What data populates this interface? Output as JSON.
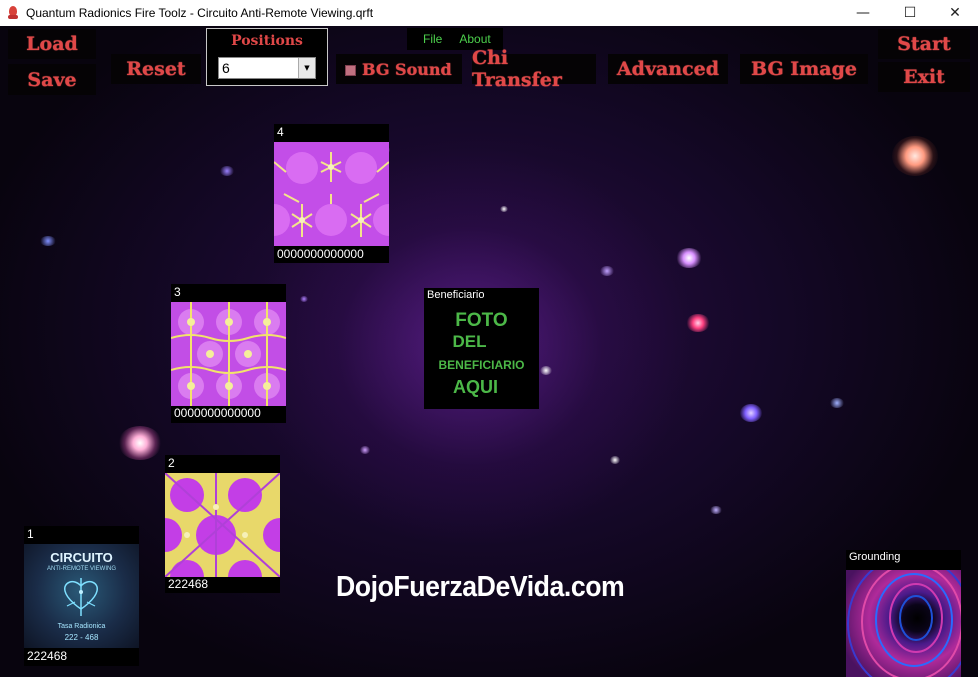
{
  "window": {
    "title": "Quantum Radionics Fire Toolz - Circuito Anti-Remote Viewing.qrft",
    "minimize_glyph": "—",
    "maximize_glyph": "☐",
    "close_glyph": "✕"
  },
  "menu": [
    {
      "label": "File"
    },
    {
      "label": "About"
    }
  ],
  "toolbar": {
    "load": "Load",
    "save": "Save",
    "reset": "Reset",
    "positions_label": "Positions",
    "positions_value": "6",
    "bg_sound": "BG Sound",
    "chi_transfer": "Chi Transfer",
    "advanced": "Advanced",
    "bg_image": "BG Image",
    "start": "Start",
    "exit": "Exit"
  },
  "cards": {
    "pos4": {
      "label": "4",
      "value": "0000000000000"
    },
    "pos3": {
      "label": "3",
      "value": "0000000000000"
    },
    "pos2": {
      "label": "2",
      "value": "222468"
    },
    "pos1": {
      "label": "1",
      "value": "222468",
      "image_title": "CIRCUITO",
      "image_subtitle": "ANTI-REMOTE VIEWING",
      "image_footer1": "Tasa Radionica",
      "image_footer2": "222 - 468"
    },
    "beneficiario": {
      "label": "Beneficiario",
      "line1": "FOTO",
      "line2": "DEL",
      "line3": "BENEFICIARIO",
      "line4": "AQUI"
    },
    "grounding": {
      "label": "Grounding"
    }
  },
  "watermark": "DojoFuerzaDeVida.com",
  "colors": {
    "button_text": "#e04848",
    "menu_text": "#4cd04c",
    "beneficiario_text": "#4cb848",
    "pattern_purple": "#c34ee8",
    "pattern_yellow": "#f2e46a"
  }
}
